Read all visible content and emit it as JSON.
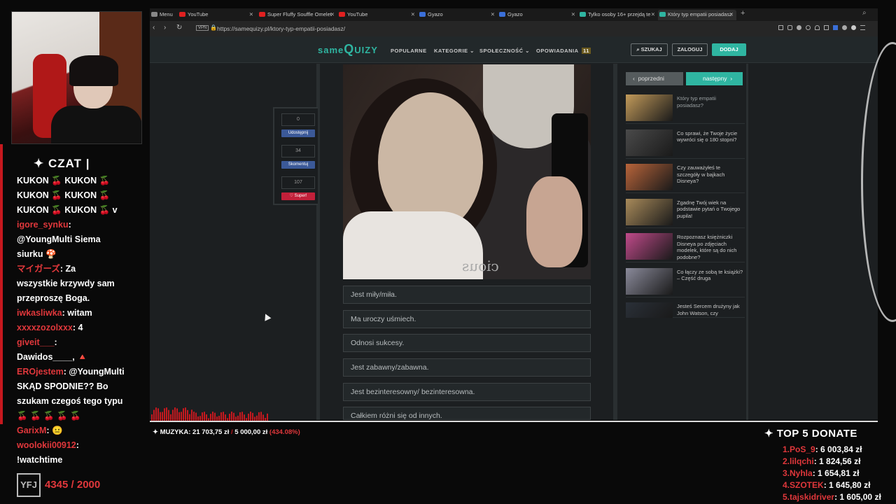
{
  "browser": {
    "tabs": [
      {
        "label": "Menu",
        "color": "#888888"
      },
      {
        "label": "YouTube",
        "color": "#e02020"
      },
      {
        "label": "Super Fluffy Souffle Omelet",
        "color": "#e02020"
      },
      {
        "label": "YouTube",
        "color": "#e02020"
      },
      {
        "label": "Gyazo",
        "color": "#3a6fd8"
      },
      {
        "label": "Gyazo",
        "color": "#3a6fd8"
      },
      {
        "label": "Tylko osoby 16+ przejdą te",
        "color": "#2fb5a1"
      },
      {
        "label": "Który typ empatii posiadasz",
        "color": "#2fb5a1"
      }
    ],
    "url": "https://samequizy.pl/ktory-typ-empatii-posiadasz/",
    "vpn_badge": "VPN"
  },
  "site": {
    "logo_same": "same",
    "logo_q": "Q",
    "logo_uizy": "UIZY",
    "nav": [
      "POPULARNE",
      "KATEGORIE ⌄",
      "SPOŁECZNOŚĆ ⌄",
      "OPOWIADANIA"
    ],
    "nav_badge": "11",
    "search": "⌕ SZUKAJ",
    "login": "ZALOGUJ",
    "add": "DODAJ",
    "accent": "#2fb5a1"
  },
  "social": {
    "share_count": "0",
    "share_label": "Udostępnij",
    "comment_count": "34",
    "comment_label": "Skomentuj",
    "like_count": "107",
    "like_label": "Super!"
  },
  "photo": {
    "mirror_text": "cious"
  },
  "answers": [
    "Jest miły/miła.",
    "Ma uroczy uśmiech.",
    "Odnosi sukcesy.",
    "Jest zabawny/zabawna.",
    "Jest bezinteresowny/ bezinteresowna.",
    "Całkiem różni się od innych."
  ],
  "sidebar": {
    "prev": "poprzedni",
    "next": "następny",
    "related": [
      {
        "title": "Który typ empatii posiadasz?",
        "color": "#c29a5a"
      },
      {
        "title": "Co sprawi, że Twoje życie wywróci się o 180 stopni?",
        "color": "#4a4a4a"
      },
      {
        "title": "Czy zauważyłeś te szczegóły w bajkach Disneya?",
        "color": "#b8643a"
      },
      {
        "title": "Zgadnę Twój wiek na podstawie pytań o Twojego pupila!",
        "color": "#a88a5a"
      },
      {
        "title": "Rozpoznasz księżniczki Disneya po zdjęciach modelek, które są do nich podobne?",
        "color": "#c04a8a"
      },
      {
        "title": "Co łączy ze sobą te książki? – Część druga",
        "color": "#8a8a9a"
      },
      {
        "title": "Jesteś Sercem drużyny jak John Watson, czy",
        "color": "#2a3038"
      }
    ]
  },
  "chat": {
    "title": "CZAT",
    "lines": [
      {
        "name": "",
        "text": "KUKON 🍒 KUKON 🍒"
      },
      {
        "name": "",
        "text": "KUKON 🍒 KUKON 🍒"
      },
      {
        "name": "",
        "text": "KUKON 🍒 KUKON 🍒 v"
      },
      {
        "name": "igore_synku",
        "text": ":"
      },
      {
        "name": "",
        "text": "@YoungMulti Siema"
      },
      {
        "name": "",
        "text": "siurku 🍄"
      },
      {
        "name": "マイガーズ",
        "text": ": Za"
      },
      {
        "name": "",
        "text": "wszystkie krzywdy sam"
      },
      {
        "name": "",
        "text": "przeproszę Boga."
      },
      {
        "name": "iwkasliwka",
        "text": ": witam"
      },
      {
        "name": "xxxxzozolxxx",
        "text": ": 4"
      },
      {
        "name": "giveit___",
        "text": ":"
      },
      {
        "name": "",
        "text": "Dawidos____, 🔺"
      },
      {
        "name": "EROjestem",
        "text": ": @YoungMulti"
      },
      {
        "name": "",
        "text": "SKĄD SPODNIE?? Bo"
      },
      {
        "name": "",
        "text": "szukam czegoś tego typu"
      },
      {
        "name": "",
        "text": "🍒 🍒 🍒 🍒 🍒"
      },
      {
        "name": "GarixM",
        "text": ": 😐"
      },
      {
        "name": "woolokii00912",
        "text": ":"
      },
      {
        "name": "",
        "text": "!watchtime"
      }
    ]
  },
  "goal": {
    "logo": "YFJ",
    "text": "4345 / 2000"
  },
  "music": {
    "label": "✦ MUZYKA:",
    "amount": "21 703,75 zł",
    "goal": "5 000,00 zł",
    "pct": "(434.08%)"
  },
  "donate": {
    "title": "✦ TOP 5 DONATE",
    "rows": [
      {
        "rank": "1.",
        "name": "PoS_9",
        "amount": ": 6 003,84 zł"
      },
      {
        "rank": "2.",
        "name": "lilqchi",
        "amount": ": 1 824,56 zł"
      },
      {
        "rank": "3.",
        "name": "Nyhla",
        "amount": ": 1 654,81 zł"
      },
      {
        "rank": "4.",
        "name": "SZOTEK",
        "amount": ": 1 645,80 zł"
      },
      {
        "rank": "5.",
        "name": "tajskidriver",
        "amount": ": 1 605,00 zł"
      }
    ]
  }
}
